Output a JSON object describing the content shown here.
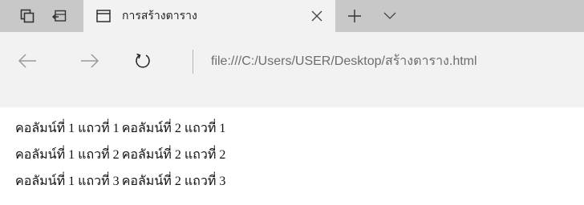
{
  "tab": {
    "title": "การสร้างตาราง"
  },
  "address": {
    "url": "file:///C:/Users/USER/Desktop/สร้างตาราง.html"
  },
  "icons": {
    "tab_actions": "tab-actions-icon",
    "set_aside": "set-aside-tabs-icon",
    "page": "page-icon",
    "close": "close-icon",
    "new_tab": "plus-icon",
    "tab_list": "chevron-down-icon",
    "back": "back-arrow-icon",
    "forward": "forward-arrow-icon",
    "refresh": "refresh-icon"
  },
  "table": {
    "rows": [
      [
        "คอลัมน์ที่ 1 แถวที่ 1",
        "คอลัมน์ที่ 2 แถวที่ 1"
      ],
      [
        "คอลัมน์ที่ 1 แถวที่ 2",
        "คอลัมน์ที่ 2 แถวที่ 2"
      ],
      [
        "คอลัมน์ที่ 1 แถวที่ 3",
        "คอลัมน์ที่ 2 แถวที่ 3"
      ]
    ]
  }
}
